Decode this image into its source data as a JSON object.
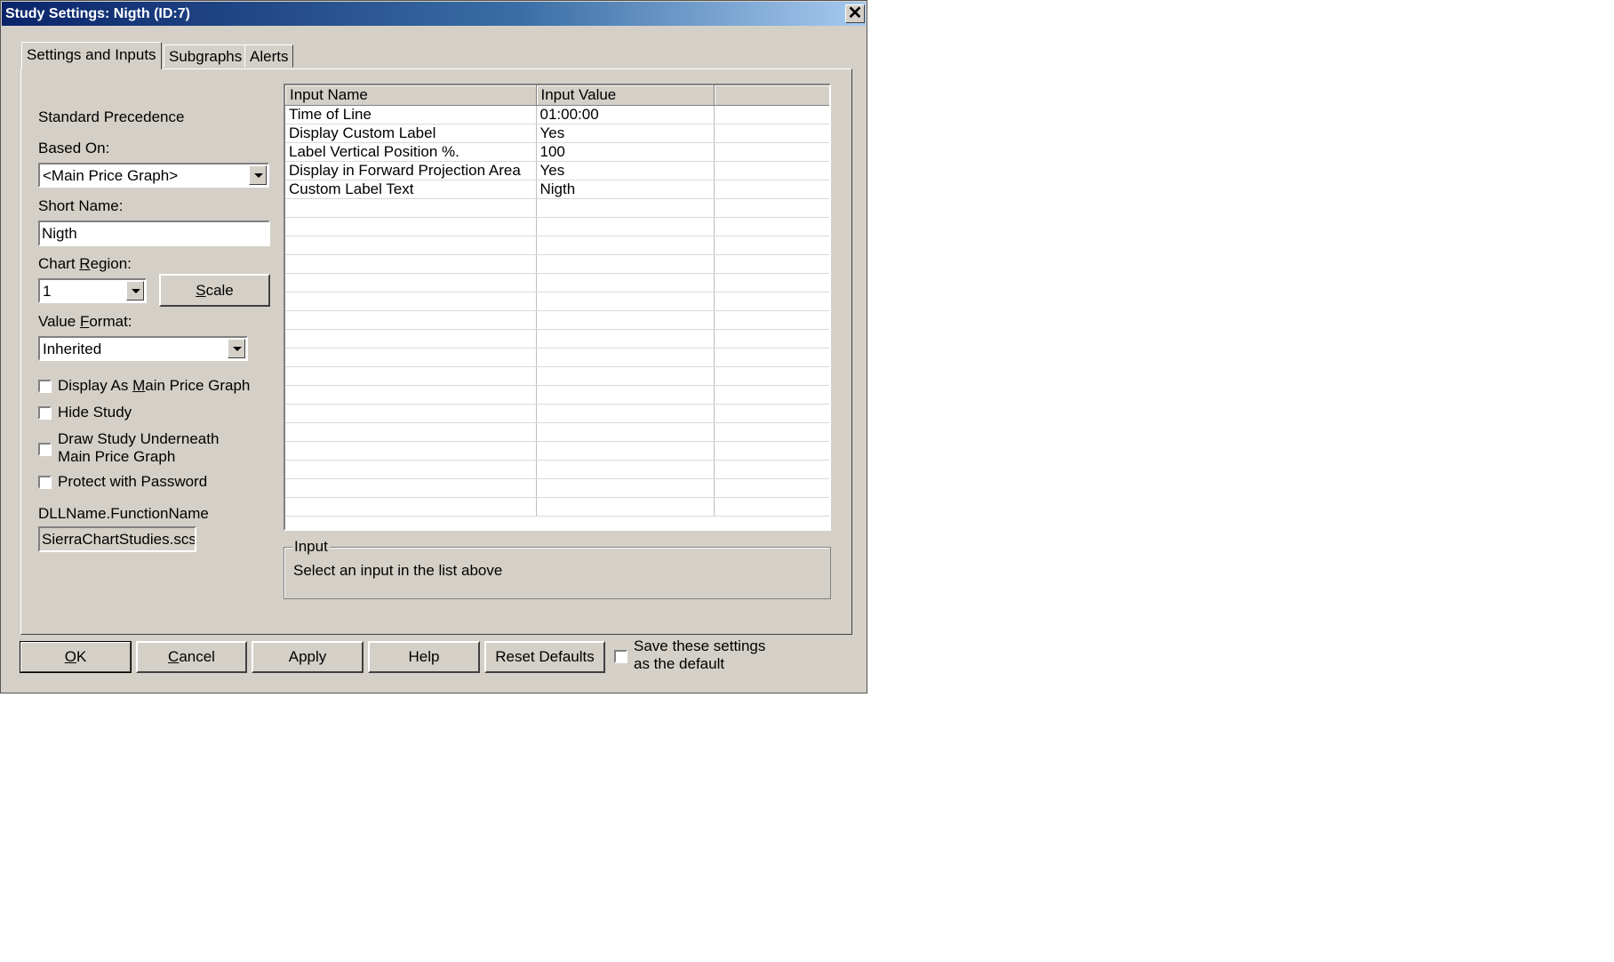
{
  "window": {
    "title": "Study Settings: Nigth (ID:7)",
    "close_glyph": "✕"
  },
  "tabs": [
    {
      "label": "Settings and Inputs"
    },
    {
      "label": "Subgraphs"
    },
    {
      "label": "Alerts"
    }
  ],
  "settings": {
    "standard_precedence_label": "Standard Precedence",
    "based_on_label": "Based On:",
    "based_on_value": "<Main Price Graph>",
    "short_name_label": "Short Name:",
    "short_name_value": "Nigth",
    "chart_region_label_pre": "Chart ",
    "chart_region_label_u": "R",
    "chart_region_label_post": "egion:",
    "chart_region_value": "1",
    "scale_button_u": "S",
    "scale_button_rest": "cale",
    "value_format_label_pre": "Value ",
    "value_format_label_u": "F",
    "value_format_label_post": "ormat:",
    "value_format_value": "Inherited",
    "checkboxes": {
      "display_as_main_pre": "Display As ",
      "display_as_main_u": "M",
      "display_as_main_post": "ain Price Graph",
      "hide_study": "Hide Study",
      "draw_underneath_line1": "Draw Study Underneath",
      "draw_underneath_line2": "Main Price Graph",
      "protect_password": "Protect with Password"
    },
    "dll_label": "DLLName.FunctionName",
    "dll_value": "SierraChartStudies.scsf_TimeLine"
  },
  "inputs_grid": {
    "headers": [
      "Input Name",
      "Input Value",
      ""
    ],
    "rows": [
      [
        "Time of Line",
        "01:00:00",
        ""
      ],
      [
        "Display Custom Label",
        "Yes",
        ""
      ],
      [
        "Label Vertical Position %.",
        "100",
        ""
      ],
      [
        "Display in Forward Projection Area",
        "Yes",
        ""
      ],
      [
        "Custom Label Text",
        "Nigth",
        ""
      ]
    ]
  },
  "input_group": {
    "legend": "Input",
    "text": "Select an input in the list above"
  },
  "buttons": {
    "ok_u": "O",
    "ok_rest": "K",
    "cancel_u": "C",
    "cancel_rest": "ancel",
    "apply": "Apply",
    "help": "Help",
    "reset": "Reset Defaults",
    "save_default_line1": "Save these settings",
    "save_default_line2": "as the default"
  }
}
